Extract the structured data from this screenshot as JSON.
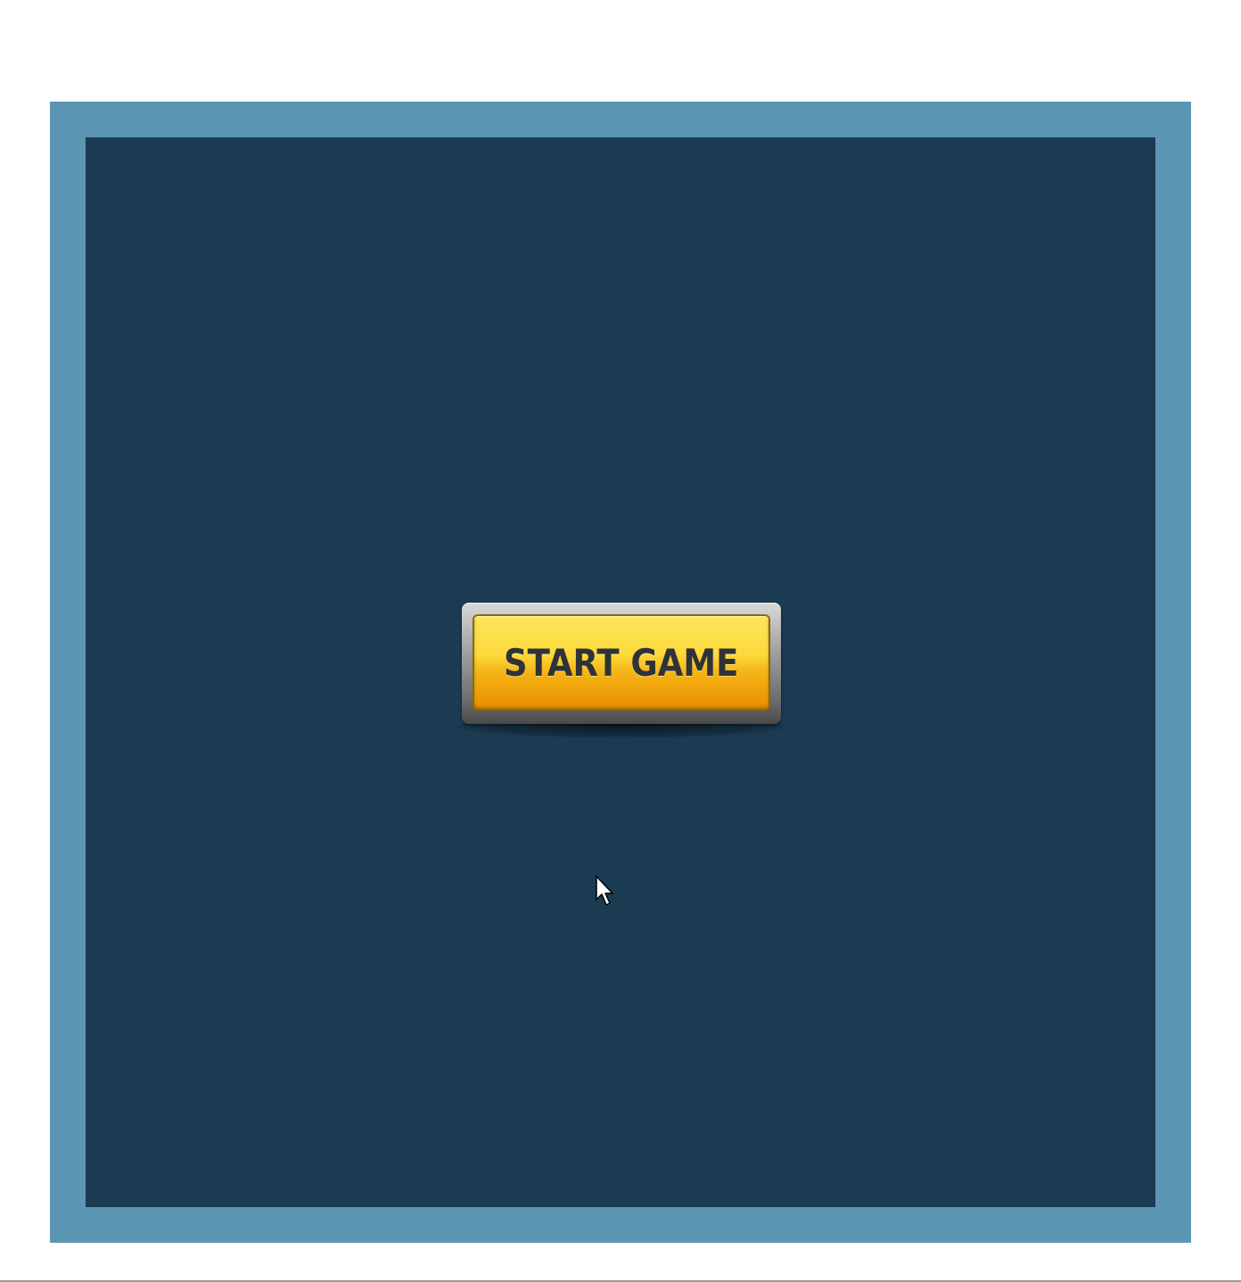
{
  "game": {
    "start_button_label": "START GAME"
  },
  "colors": {
    "frame": "#5b97b4",
    "canvas": "#1b3b53",
    "button_face": "#fcd93a",
    "button_text": "#2f3337"
  },
  "icons": {
    "cursor": "mouse-pointer-icon"
  }
}
